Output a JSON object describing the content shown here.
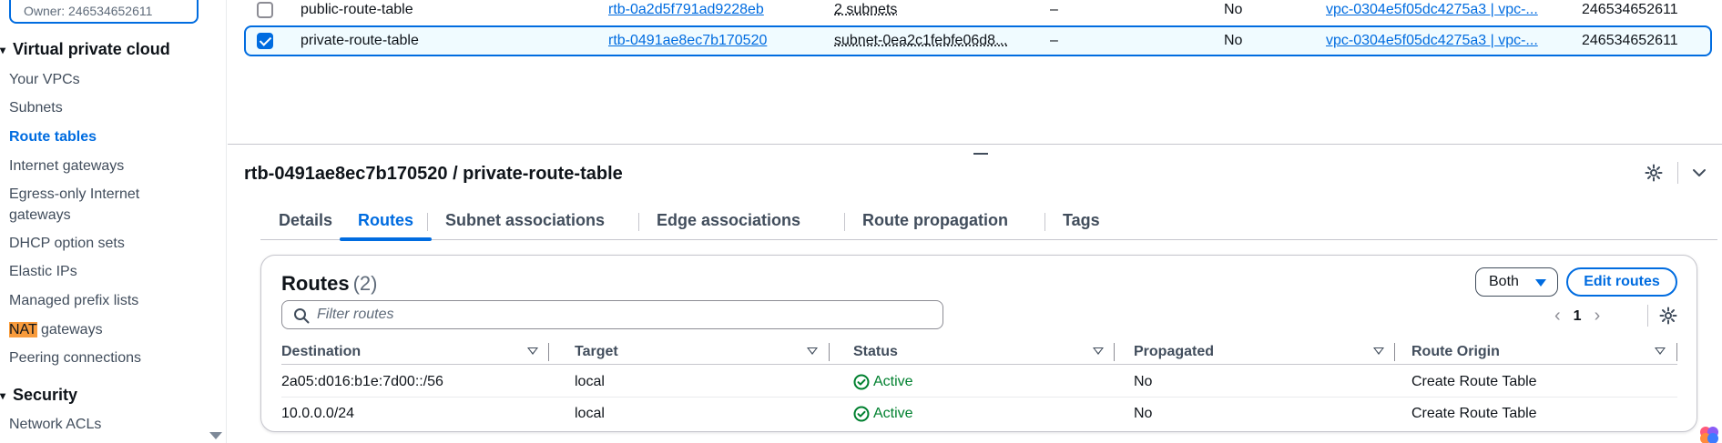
{
  "sidebar": {
    "owner_text": "Owner: 246534652611",
    "sections": [
      {
        "label": "Virtual private cloud"
      },
      {
        "label": "Security"
      }
    ],
    "items": [
      {
        "label": "Your VPCs"
      },
      {
        "label": "Subnets"
      },
      {
        "label": "Route tables"
      },
      {
        "label": "Internet gateways"
      },
      {
        "label": "Egress-only Internet"
      },
      {
        "label": "gateways"
      },
      {
        "label": "DHCP option sets"
      },
      {
        "label": "Elastic IPs"
      },
      {
        "label": "Managed prefix lists"
      },
      {
        "label_hl": "NAT",
        "label_rest": " gateways"
      },
      {
        "label": "Peering connections"
      },
      {
        "label": "Network ACLs"
      }
    ]
  },
  "route_tables": [
    {
      "name": "public-route-table",
      "id": "rtb-0a2d5f791ad9228eb",
      "subnets": "2 subnets",
      "edge": "–",
      "main": "No",
      "vpc": "vpc-0304e5f05dc4275a3 | vpc-...",
      "owner": "246534652611",
      "selected": false
    },
    {
      "name": "private-route-table",
      "id": "rtb-0491ae8ec7b170520",
      "subnets": "subnet-0ea2c1febfe06d8...",
      "edge": "–",
      "main": "No",
      "vpc": "vpc-0304e5f05dc4275a3 | vpc-...",
      "owner": "246534652611",
      "selected": true
    }
  ],
  "detail": {
    "title": "rtb-0491ae8ec7b170520 / private-route-table",
    "tabs": [
      "Details",
      "Routes",
      "Subnet associations",
      "Edge associations",
      "Route propagation",
      "Tags"
    ],
    "active_tab": "Routes"
  },
  "routes_panel": {
    "title": "Routes",
    "count": "(2)",
    "filter_button": "Both",
    "edit_button": "Edit routes",
    "filter_placeholder": "Filter routes",
    "page": "1",
    "columns": [
      "Destination",
      "Target",
      "Status",
      "Propagated",
      "Route Origin"
    ],
    "rows": [
      {
        "destination": "2a05:d016:b1e:7d00::/56",
        "target": "local",
        "status": "Active",
        "propagated": "No",
        "origin": "Create Route Table"
      },
      {
        "destination": "10.0.0.0/24",
        "target": "local",
        "status": "Active",
        "propagated": "No",
        "origin": "Create Route Table"
      }
    ]
  },
  "colors": {
    "accent": "#006ce0",
    "success": "#00802f",
    "highlight": "#f89b3c",
    "selected_row_bg": "#f0fbff"
  },
  "icons": [
    "checkbox",
    "checkbox-checked",
    "gear-icon",
    "chevron-down-icon",
    "search-icon",
    "caret-down-icon",
    "chevron-left-icon",
    "chevron-right-icon",
    "success-check-icon",
    "sort-icon",
    "assistant-icon"
  ]
}
